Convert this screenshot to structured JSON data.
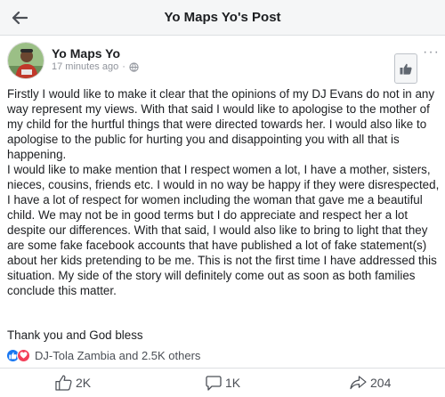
{
  "header": {
    "title": "Yo Maps Yo's Post",
    "back_icon": "arrow-left-icon"
  },
  "post": {
    "author": "Yo Maps Yo",
    "time": "17 minutes ago",
    "meta_separator": "·",
    "privacy_icon": "globe-icon",
    "more_label": "···",
    "paragraphs": [
      "Firstly I would like to make it clear that the opinions of my DJ Evans do not in any way represent my views. With that said I would like to apologise to the mother of my child for the hurtful things that were directed towards her. I would also like to apologise to the public for hurting you and disappointing you with all that is happening.",
      "I would like to make mention that I respect women a lot, I have a mother, sisters, nieces, cousins, friends etc. I would in no way be happy if they were disrespected, I have a lot of respect for women including the woman that gave me a beautiful child. We may not be in good terms but I do appreciate and respect her a lot despite our differences. With that said, I would also like to bring to light that they are some fake facebook accounts that have published a lot of fake statement(s) about her kids pretending to be me. This is not the first time I have addressed this situation. My side of the story will definitely come out as soon as both families conclude this matter."
    ],
    "closing": "Thank you and God bless",
    "reactions_text": "DJ-Tola Zambia and 2.5K others",
    "reaction_icons": [
      "like-reaction-icon",
      "love-reaction-icon"
    ],
    "colors": {
      "like_blue": "#1877f2",
      "love_red": "#f33e58",
      "muted": "#90949c"
    }
  },
  "actions": {
    "like_count": "2K",
    "comment_count": "1K",
    "share_count": "204"
  }
}
